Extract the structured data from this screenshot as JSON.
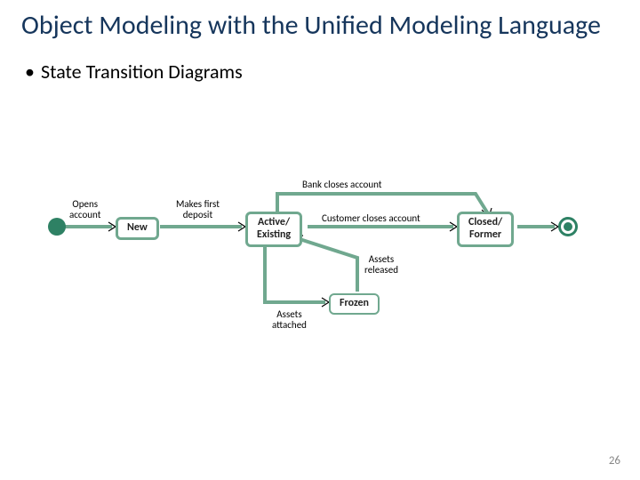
{
  "title": "Object Modeling with the Unified Modeling Language",
  "bullet": "State Transition Diagrams",
  "pagenum": "26",
  "diagram": {
    "states": {
      "new": "New",
      "active_l1": "Active/",
      "active_l2": "Existing",
      "frozen": "Frozen",
      "closed_l1": "Closed/",
      "closed_l2": "Former"
    },
    "transitions": {
      "opens_l1": "Opens",
      "opens_l2": "account",
      "first_l1": "Makes first",
      "first_l2": "deposit",
      "bank_closes": "Bank closes account",
      "cust_closes": "Customer closes account",
      "assets_att_l1": "Assets",
      "assets_att_l2": "attached",
      "assets_rel_l1": "Assets",
      "assets_rel_l2": "released"
    }
  }
}
